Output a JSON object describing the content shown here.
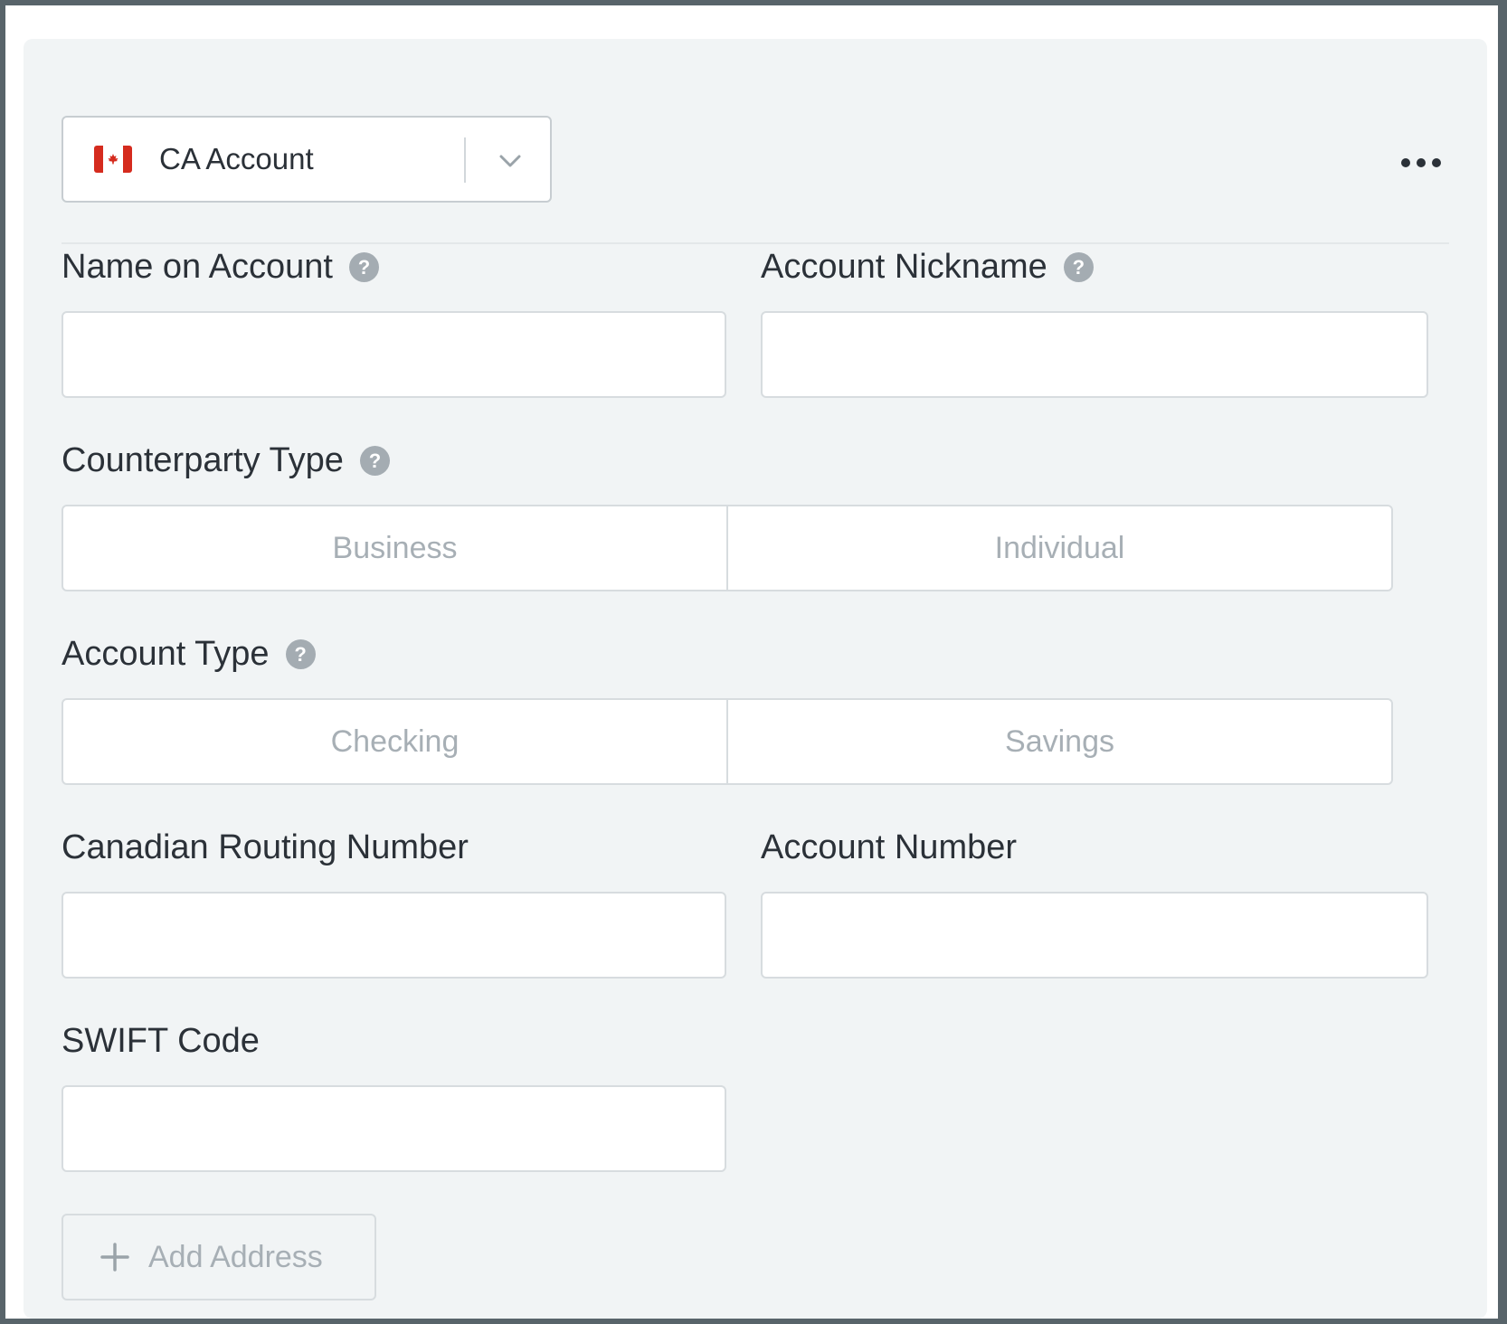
{
  "selector": {
    "flag_icon": "canada-flag-icon",
    "label": "CA Account",
    "chevron_icon": "chevron-down-icon"
  },
  "more_icon": "more-horizontal-icon",
  "fields": {
    "name_on_account": {
      "label": "Name on Account",
      "value": "",
      "placeholder": ""
    },
    "account_nickname": {
      "label": "Account Nickname",
      "value": "",
      "placeholder": ""
    },
    "counterparty_type": {
      "label": "Counterparty Type",
      "options": [
        "Business",
        "Individual"
      ]
    },
    "account_type": {
      "label": "Account Type",
      "options": [
        "Checking",
        "Savings"
      ]
    },
    "canadian_routing_number": {
      "label": "Canadian Routing Number",
      "value": "",
      "placeholder": ""
    },
    "account_number": {
      "label": "Account Number",
      "value": "",
      "placeholder": ""
    },
    "swift_code": {
      "label": "SWIFT Code",
      "value": "",
      "placeholder": ""
    }
  },
  "help_glyph": "?",
  "add_address": {
    "icon": "plus-icon",
    "label": "Add Address"
  },
  "colors": {
    "panel_bg": "#f1f4f5",
    "flag_red": "#d52b1e",
    "muted_text": "#a7afb5",
    "help_badge": "#a4acb2"
  }
}
